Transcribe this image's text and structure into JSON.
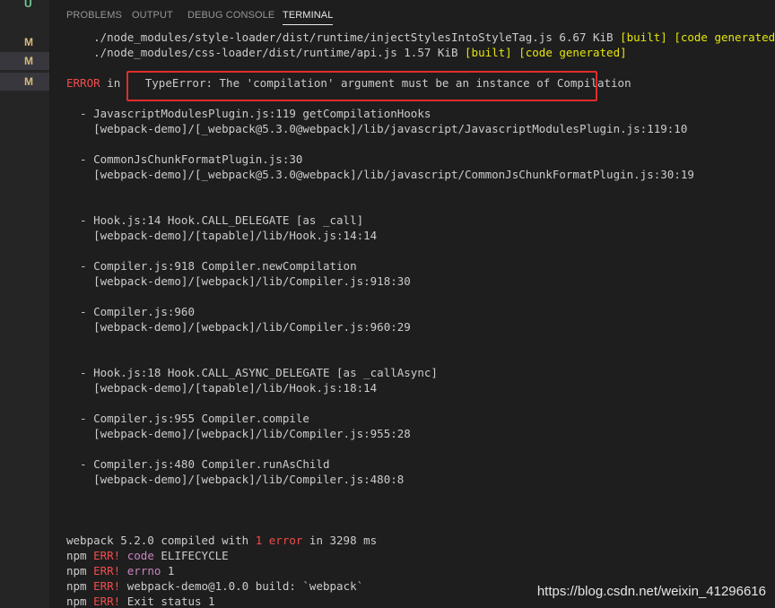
{
  "gutter": {
    "items": [
      {
        "badge": "U"
      },
      {
        "badge": "M"
      },
      {
        "badge": "M"
      },
      {
        "badge": "M"
      }
    ]
  },
  "panel": {
    "tabs": [
      {
        "label": "PROBLEMS"
      },
      {
        "label": "OUTPUT"
      },
      {
        "label": "DEBUG CONSOLE"
      },
      {
        "label": "TERMINAL"
      }
    ],
    "active_tab": "TERMINAL"
  },
  "terminal": {
    "module_lines": [
      {
        "path": "    ./node_modules/style-loader/dist/runtime/injectStylesIntoStyleTag.js 6.67 KiB ",
        "tags": "[built] [code generated]"
      },
      {
        "path": "    ./node_modules/css-loader/dist/runtime/api.js 1.57 KiB ",
        "tags": "[built] [code generated]"
      }
    ],
    "error_prefix": "ERROR",
    "error_in": " in ",
    "error_message": "TypeError: The 'compilation' argument must be an instance of Compilation",
    "stack": [
      "  - JavascriptModulesPlugin.js:119 getCompilationHooks",
      "    [webpack-demo]/[_webpack@5.3.0@webpack]/lib/javascript/JavascriptModulesPlugin.js:119:10",
      "  - CommonJsChunkFormatPlugin.js:30",
      "    [webpack-demo]/[_webpack@5.3.0@webpack]/lib/javascript/CommonJsChunkFormatPlugin.js:30:19",
      "  - Hook.js:14 Hook.CALL_DELEGATE [as _call]",
      "    [webpack-demo]/[tapable]/lib/Hook.js:14:14",
      "  - Compiler.js:918 Compiler.newCompilation",
      "    [webpack-demo]/[webpack]/lib/Compiler.js:918:30",
      "  - Compiler.js:960",
      "    [webpack-demo]/[webpack]/lib/Compiler.js:960:29",
      "  - Hook.js:18 Hook.CALL_ASYNC_DELEGATE [as _callAsync]",
      "    [webpack-demo]/[tapable]/lib/Hook.js:18:14",
      "  - Compiler.js:955 Compiler.compile",
      "    [webpack-demo]/[webpack]/lib/Compiler.js:955:28",
      "  - Compiler.js:480 Compiler.runAsChild",
      "    [webpack-demo]/[webpack]/lib/Compiler.js:480:8"
    ],
    "summary": {
      "before": "webpack 5.2.0 compiled with ",
      "count": "1 error",
      "after": " in 3298 ms"
    },
    "npm_lines": [
      {
        "prefix": "npm ",
        "err": "ERR!",
        "key": " code",
        "rest": " ELIFECYCLE"
      },
      {
        "prefix": "npm ",
        "err": "ERR!",
        "key": " errno",
        "rest": " 1"
      },
      {
        "prefix": "npm ",
        "err": "ERR!",
        "key": "",
        "rest": " webpack-demo@1.0.0 build: `webpack`"
      },
      {
        "prefix": "npm ",
        "err": "ERR!",
        "key": "",
        "rest": " Exit status 1"
      }
    ]
  },
  "watermark": "https://blog.csdn.net/weixin_41296616",
  "colors": {
    "background": "#1e1e1e",
    "error_red": "#f14c4c",
    "built_yellow": "#e5e510",
    "highlight_box": "#e32b2b"
  }
}
